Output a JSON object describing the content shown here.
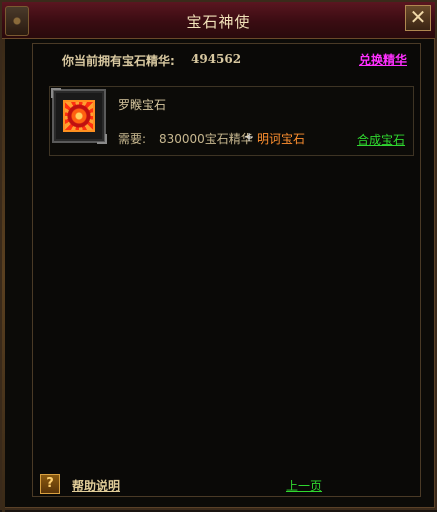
{
  "window": {
    "title": "宝石神使",
    "close_label": "✕"
  },
  "essence": {
    "label": "你当前拥有宝石精华:",
    "value": "494562",
    "exchange_label": "兑换精华"
  },
  "gem": {
    "name": "罗睺宝石",
    "icon": "red-gem-icon",
    "requirement_label": "需要:",
    "requirement_cost": "830000宝石精华",
    "plus": "+",
    "requirement_item": "明诃宝石",
    "synthesize_label": "合成宝石"
  },
  "footer": {
    "help_icon_text": "?",
    "help_label": "帮助说明",
    "prev_page_label": "上一页"
  },
  "colors": {
    "title_bar": "#4a1018",
    "exchange_link": "#ff30ff",
    "action_link": "#30d830",
    "item_orange": "#ff9030",
    "text": "#d8c8a0"
  }
}
